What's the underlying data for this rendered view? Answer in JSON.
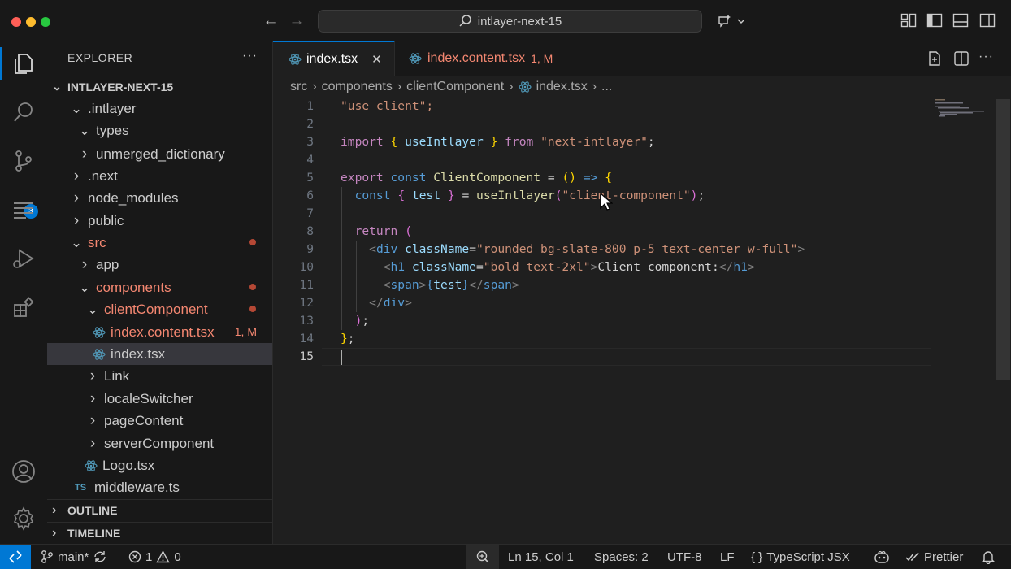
{
  "window": {
    "search_text": "intlayer-next-15"
  },
  "activity_bar": {
    "scm_badge": "3"
  },
  "explorer": {
    "title": "EXPLORER",
    "more": "···",
    "root": "INTLAYER-NEXT-15",
    "items": [
      {
        "label": ".intlayer",
        "chevron": "⌄",
        "color": "#cccccc",
        "icon": "none"
      },
      {
        "label": "types",
        "chevron": "⌄",
        "color": "#cccccc",
        "icon": "none"
      },
      {
        "label": "unmerged_dictionary",
        "chevron": "›",
        "color": "#cccccc",
        "icon": "none"
      },
      {
        "label": ".next",
        "chevron": "›",
        "color": "#cccccc",
        "icon": "none"
      },
      {
        "label": "node_modules",
        "chevron": "›",
        "color": "#cccccc",
        "icon": "none"
      },
      {
        "label": "public",
        "chevron": "›",
        "color": "#cccccc",
        "icon": "none"
      },
      {
        "label": "src",
        "chevron": "⌄",
        "color": "#f48771",
        "icon": "none"
      },
      {
        "label": "app",
        "chevron": "›",
        "color": "#cccccc",
        "icon": "none"
      },
      {
        "label": "components",
        "chevron": "⌄",
        "color": "#f48771",
        "icon": "none"
      },
      {
        "label": "clientComponent",
        "chevron": "⌄",
        "color": "#f48771",
        "icon": "none"
      },
      {
        "label": "index.content.tsx",
        "chevron": "",
        "color": "#f48771",
        "icon": "react",
        "status": "1, M"
      },
      {
        "label": "index.tsx",
        "chevron": "",
        "color": "#cccccc",
        "icon": "react"
      },
      {
        "label": "Link",
        "chevron": "›",
        "color": "#cccccc",
        "icon": "none"
      },
      {
        "label": "localeSwitcher",
        "chevron": "›",
        "color": "#cccccc",
        "icon": "none"
      },
      {
        "label": "pageContent",
        "chevron": "›",
        "color": "#cccccc",
        "icon": "none"
      },
      {
        "label": "serverComponent",
        "chevron": "›",
        "color": "#cccccc",
        "icon": "none"
      },
      {
        "label": "Logo.tsx",
        "chevron": "",
        "color": "#cccccc",
        "icon": "react"
      },
      {
        "label": "middleware.ts",
        "chevron": "",
        "color": "#cccccc",
        "icon": "ts"
      }
    ],
    "ts_icon_text": "TS",
    "outline": "OUTLINE",
    "timeline": "TIMELINE"
  },
  "tabs": [
    {
      "label": "index.tsx",
      "close": "✕",
      "active": true
    },
    {
      "label": "index.content.tsx",
      "status": "1, M",
      "active": false
    }
  ],
  "breadcrumb": [
    "src",
    "components",
    "clientComponent",
    "index.tsx",
    "..."
  ],
  "code_lines": [
    "1",
    "2",
    "3",
    "4",
    "5",
    "6",
    "7",
    "8",
    "9",
    "10",
    "11",
    "12",
    "13",
    "14",
    "15"
  ],
  "code": {
    "l1": "\"use client\";",
    "l3_import": "import",
    "l3_name": "useIntlayer",
    "l3_from": "from",
    "l3_mod": "\"next-intlayer\"",
    "l5_export": "export",
    "l5_const": "const",
    "l5_name": "ClientComponent",
    "l5_arrow": "=>",
    "l6_const": "const",
    "l6_var": "test",
    "l6_fn": "useIntlayer",
    "l6_arg": "\"client-component\"",
    "l8_return": "return",
    "l9_tag": "div",
    "l9_attr": "className",
    "l9_val": "\"rounded bg-slate-800 p-5 text-center w-full\"",
    "l10_tag": "h1",
    "l10_attr": "className",
    "l10_val": "\"bold text-2xl\"",
    "l10_text": "Client component:",
    "l11_tag": "span",
    "l11_expr": "test",
    "l12_tag": "div"
  },
  "status_bar": {
    "branch": "main*",
    "errors": "1",
    "warnings": "0",
    "position": "Ln 15, Col 1",
    "spaces": "Spaces: 2",
    "encoding": "UTF-8",
    "eol": "LF",
    "language": "TypeScript JSX",
    "formatter": "Prettier"
  }
}
